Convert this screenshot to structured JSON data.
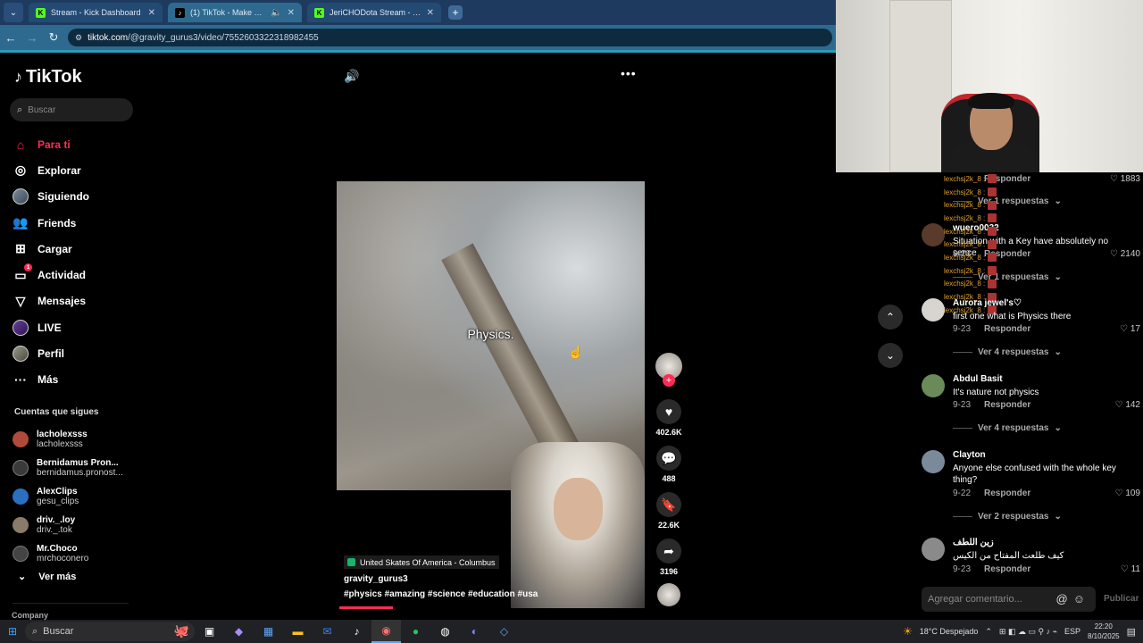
{
  "browser": {
    "tabs": [
      {
        "title": "Stream - Kick Dashboard",
        "icon": "kick-icon",
        "active": false
      },
      {
        "title": "(1) TikTok - Make Your Day",
        "icon": "tiktok-icon",
        "active": true
      },
      {
        "title": "JeriCHODota Stream - Watch L",
        "icon": "kick-icon",
        "active": false
      }
    ],
    "url_host": "tiktok.com",
    "url_path": "/@gravity_gurus3/video/7552603322318982455"
  },
  "tiktok": {
    "logo": "TikTok",
    "search_placeholder": "Buscar",
    "nav": [
      {
        "label": "Para ti",
        "icon": "home-icon",
        "active": true
      },
      {
        "label": "Explorar",
        "icon": "compass-icon"
      },
      {
        "label": "Siguiendo",
        "icon": "avatar-icon"
      },
      {
        "label": "Friends",
        "icon": "friends-icon"
      },
      {
        "label": "Cargar",
        "icon": "upload-icon"
      },
      {
        "label": "Actividad",
        "icon": "activity-icon",
        "badge": "1"
      },
      {
        "label": "Mensajes",
        "icon": "messages-icon"
      },
      {
        "label": "LIVE",
        "icon": "live-icon"
      },
      {
        "label": "Perfil",
        "icon": "profile-icon"
      },
      {
        "label": "Más",
        "icon": "more-icon"
      }
    ],
    "following_title": "Cuentas que sigues",
    "following": [
      {
        "name": "lacholexsss",
        "handle": "lacholexsss",
        "color": "#b04a3a"
      },
      {
        "name": "Bernidamus Pron...",
        "handle": "bernidamus.pronost...",
        "color": "#3a3a3a"
      },
      {
        "name": "AlexClips",
        "handle": "gesu_clips",
        "color": "#2a6fc0"
      },
      {
        "name": "driv._.loy",
        "handle": "driv._.tok",
        "color": "#8a7a6a"
      },
      {
        "name": "Mr.Choco",
        "handle": "mrchoconero",
        "color": "#444"
      }
    ],
    "see_more": "Ver más",
    "company": "Company"
  },
  "video": {
    "caption": "Physics.",
    "location": "United Skates Of America - Columbus",
    "username": "gravity_gurus3",
    "hashtags": "#physics  #amazing  #science  #education  #usa",
    "likes": "402.6K",
    "comments": "488",
    "saves": "22.6K",
    "shares": "3196"
  },
  "chat": {
    "user": "lexchsj2k_8 :",
    "lines": 11
  },
  "comments": [
    {
      "name": "",
      "text": "",
      "date": "",
      "reply": "Responder",
      "likes": "1883",
      "more": "Ver 1 respuestas",
      "avatar": "#333"
    },
    {
      "name": "wuero0032",
      "text": "Situation with a Key have absolutely no sence",
      "date": "9-23",
      "reply": "Responder",
      "likes": "2140",
      "more": "Ver 1 respuestas",
      "avatar": "#5a3a2a"
    },
    {
      "name": "Aurora jewel's♡",
      "text": "first one what is Physics there",
      "date": "9-23",
      "reply": "Responder",
      "likes": "17",
      "more": "Ver 4 respuestas",
      "avatar": "#d8d4cf"
    },
    {
      "name": "Abdul Basit",
      "text": "It's nature not physics",
      "date": "9-23",
      "reply": "Responder",
      "likes": "142",
      "more": "Ver 4 respuestas",
      "avatar": "#6a8a5a"
    },
    {
      "name": "Clayton",
      "text": "Anyone else confused with the whole key thing?",
      "date": "9-22",
      "reply": "Responder",
      "likes": "109",
      "more": "Ver 2 respuestas",
      "avatar": "#7a8a9a"
    },
    {
      "name": "زين اللطف",
      "text": "كيف طلعت المفتاح من الكيس",
      "date": "9-23",
      "reply": "Responder",
      "likes": "11",
      "more": "",
      "avatar": "#8a8a8a"
    }
  ],
  "comment_input_placeholder": "Agregar comentario...",
  "publish_label": "Publicar",
  "taskbar": {
    "search_placeholder": "Buscar",
    "weather": "18°C  Despejado",
    "lang": "ESP",
    "time": "22:20",
    "date": "8/10/2025"
  },
  "colors": {
    "accent": "#fe2c55",
    "chrome": "#2e6a8f"
  }
}
